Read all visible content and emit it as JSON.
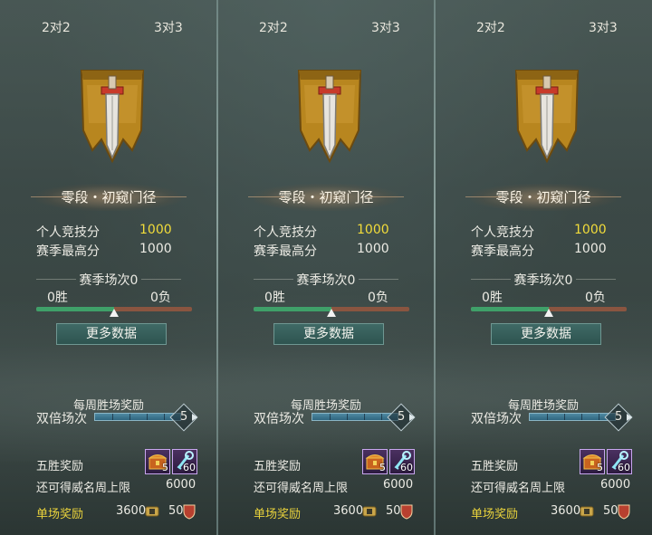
{
  "colors": {
    "highlight_value": "#f2dc3a",
    "single_reward_label": "#e9d23c",
    "win_bar": "#3fa069",
    "loss_bar": "#8a5540",
    "button_bg": "#2e5450"
  },
  "panels": [
    {
      "tabs": {
        "mode2": "2对2",
        "mode3": "3对3",
        "active": "mode2"
      },
      "rank_title": "零段・初窥门径",
      "personal_score_label": "个人竞技分",
      "personal_score": "1000",
      "season_high_label": "赛季最高分",
      "season_high": "1000",
      "season_matches": "赛季场次0",
      "wins": "0胜",
      "losses": "0负",
      "win_ratio": 0.5,
      "more_data_label": "更多数据",
      "weekly_reward_title": "每周胜场奖励",
      "double_label": "双倍场次",
      "double_count": "5",
      "five_win_label": "五胜奖励",
      "item1_count": "5",
      "item2_count": "60",
      "prestige_cap_label": "还可得威名周上限",
      "prestige_cap": "6000",
      "single_reward_label": "单场奖励",
      "single_coin": "3600",
      "single_shield": "50",
      "icons": {
        "emblem": "sword-banner-icon",
        "item1": "treasure-chest-icon",
        "item2": "jade-key-icon",
        "coin": "coin-icon",
        "shield": "shield-icon"
      }
    },
    {
      "tabs": {
        "mode2": "2对2",
        "mode3": "3对3",
        "active": "mode3"
      },
      "rank_title": "零段・初窥门径",
      "personal_score_label": "个人竞技分",
      "personal_score": "1000",
      "season_high_label": "赛季最高分",
      "season_high": "1000",
      "season_matches": "赛季场次0",
      "wins": "0胜",
      "losses": "0负",
      "win_ratio": 0.5,
      "more_data_label": "更多数据",
      "weekly_reward_title": "每周胜场奖励",
      "double_label": "双倍场次",
      "double_count": "5",
      "five_win_label": "五胜奖励",
      "item1_count": "5",
      "item2_count": "60",
      "prestige_cap_label": "还可得威名周上限",
      "prestige_cap": "6000",
      "single_reward_label": "单场奖励",
      "single_coin": "3600",
      "single_shield": "50",
      "icons": {
        "emblem": "sword-banner-icon",
        "item1": "treasure-chest-icon",
        "item2": "jade-key-icon",
        "coin": "coin-icon",
        "shield": "shield-icon"
      }
    },
    {
      "tabs": {
        "mode2": "2对2",
        "mode3": "3对3",
        "active": "none"
      },
      "rank_title": "零段・初窥门径",
      "personal_score_label": "个人竞技分",
      "personal_score": "1000",
      "season_high_label": "赛季最高分",
      "season_high": "1000",
      "season_matches": "赛季场次0",
      "wins": "0胜",
      "losses": "0负",
      "win_ratio": 0.5,
      "more_data_label": "更多数据",
      "weekly_reward_title": "每周胜场奖励",
      "double_label": "双倍场次",
      "double_count": "5",
      "five_win_label": "五胜奖励",
      "item1_count": "5",
      "item2_count": "60",
      "prestige_cap_label": "还可得威名周上限",
      "prestige_cap": "6000",
      "single_reward_label": "单场奖励",
      "single_coin": "3600",
      "single_shield": "50",
      "icons": {
        "emblem": "sword-banner-icon",
        "item1": "treasure-chest-icon",
        "item2": "jade-key-icon",
        "coin": "coin-icon",
        "shield": "shield-icon"
      }
    }
  ]
}
